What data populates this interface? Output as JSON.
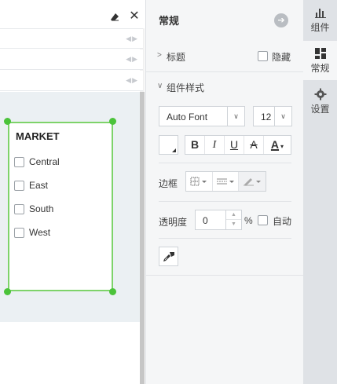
{
  "canvas": {
    "widget": {
      "title": "MARKET",
      "options": [
        "Central",
        "East",
        "South",
        "West"
      ]
    }
  },
  "panel": {
    "title": "常规",
    "section_title": {
      "label": "标题",
      "hide_label": "隐藏"
    },
    "section_style": {
      "label": "组件样式"
    },
    "font": {
      "value": "Auto Font",
      "size": "12"
    },
    "format_buttons": [
      "B",
      "I",
      "U",
      "A",
      "A"
    ],
    "border_label": "边框",
    "opacity": {
      "label": "透明度",
      "value": "0",
      "unit": "%",
      "auto_label": "自动"
    }
  },
  "tabs": [
    {
      "label": "组件",
      "icon": "bar-chart-icon"
    },
    {
      "label": "常规",
      "icon": "layout-grid-icon"
    },
    {
      "label": "设置",
      "icon": "gear-icon"
    }
  ],
  "colors": {
    "selection": "#7ed36a",
    "handle": "#4bc33a",
    "canvas_bg": "#ebf0f3",
    "panel_bg": "#f5f6f7",
    "tabs_bg": "#dfe2e6"
  }
}
